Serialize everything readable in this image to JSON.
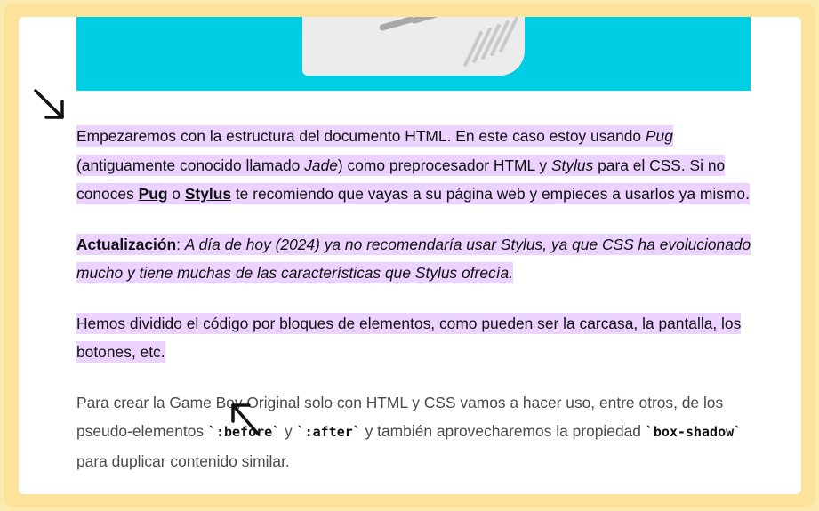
{
  "paragraphs": {
    "p1": {
      "t1": "Empezaremos con la estructura del documento HTML. En este caso estoy usando ",
      "i1": "Pug",
      "t2": " (antiguamente conocido llamado ",
      "i2": "Jade",
      "t3": ") como preprocesador HTML y ",
      "i3": "Stylus",
      "t4": " para el CSS. Si no conoces ",
      "link1": "Pug",
      "t5": " o ",
      "link2": "Stylus",
      "t6": " te recomiendo que vayas a su página web y empieces a usarlos ya mismo."
    },
    "p2": {
      "label": "Actualización",
      "sep": ": ",
      "text": "A día de hoy (2024) ya no recomendaría usar Stylus, ya que CSS ha evolucionado mucho y tiene muchas de las características que Stylus ofrecía."
    },
    "p3": {
      "text": "Hemos dividido el código por bloques de elementos, como pueden ser la carcasa, la pantalla, los botones, etc."
    },
    "p4": {
      "t1": "Para crear la Game Boy Original solo con HTML y CSS vamos a hacer uso, entre otros, de los pseudo-elementos ",
      "code1": "`:before`",
      "t2": " y ",
      "code2": "`:after`",
      "t3": " y también aprovecharemos la propiedad ",
      "code3": "`box-shadow`",
      "t4": " para duplicar contenido similar."
    }
  },
  "arrows": {
    "top_glyph": "↘",
    "bottom_glyph": "↖"
  },
  "colors": {
    "frame": "#fce9ad",
    "hero": "#00cfe3",
    "highlight": "#ecd2ff"
  }
}
